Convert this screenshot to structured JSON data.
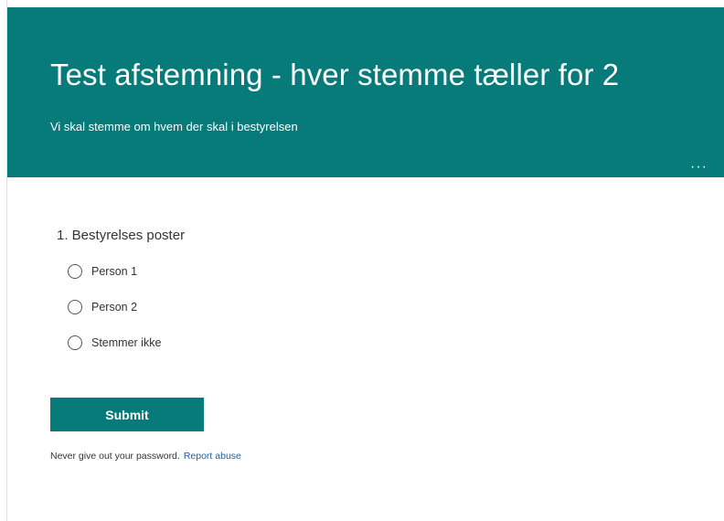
{
  "header": {
    "title": "Test afstemning - hver stemme tæller for 2",
    "subtitle": "Vi skal stemme om hvem der skal i bestyrelsen",
    "more_icon": "···"
  },
  "question": {
    "label": "1. Bestyrelses poster",
    "options": [
      {
        "label": "Person 1"
      },
      {
        "label": "Person 2"
      },
      {
        "label": "Stemmer ikke"
      }
    ]
  },
  "submit_label": "Submit",
  "footer": {
    "notice": "Never give out your password.",
    "report_link": "Report abuse"
  },
  "colors": {
    "accent": "#077a7a",
    "link": "#1a5fb4"
  }
}
